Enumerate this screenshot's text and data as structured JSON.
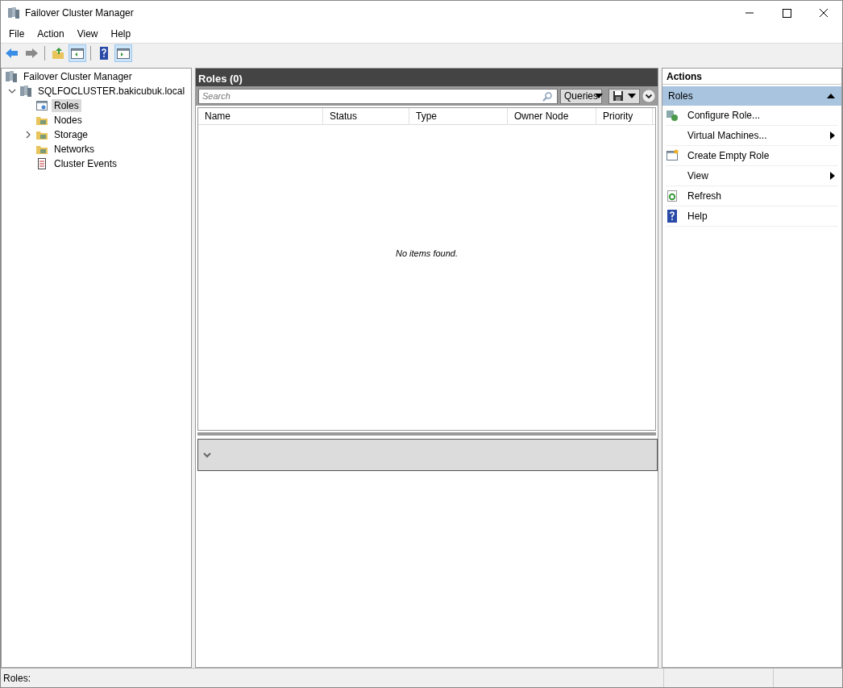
{
  "window": {
    "title": "Failover Cluster Manager"
  },
  "menu": [
    "File",
    "Action",
    "View",
    "Help"
  ],
  "toolbar": [
    {
      "pressed": false
    },
    {
      "pressed": false
    },
    {
      "pressed": false
    },
    {
      "pressed": true
    },
    {
      "pressed": false
    },
    {
      "pressed": true
    }
  ],
  "tree": [
    {
      "label": "Failover Cluster Manager",
      "selected": false,
      "children": [
        {
          "label": "SQLFOCLUSTER.bakicubuk.local",
          "selected": false,
          "expanded": true,
          "children": [
            {
              "label": "Roles",
              "selected": true
            },
            {
              "label": "Nodes",
              "selected": false
            },
            {
              "label": "Storage",
              "selected": false,
              "expanded": false
            },
            {
              "label": "Networks",
              "selected": false
            },
            {
              "label": "Cluster Events",
              "selected": false
            }
          ]
        }
      ]
    }
  ],
  "center": {
    "title": "Roles (0)",
    "search": {
      "placeholder": "Search"
    },
    "queries_button": "Queries",
    "columns": [
      "Name",
      "Status",
      "Type",
      "Owner Node",
      "Priority"
    ],
    "empty_message": "No items found."
  },
  "actions": {
    "title": "Actions",
    "section": "Roles",
    "items": [
      {
        "label": "Configure Role...",
        "submenu": false
      },
      {
        "label": "Virtual Machines...",
        "submenu": true
      },
      {
        "label": "Create Empty Role",
        "submenu": false
      },
      {
        "label": "View",
        "submenu": true
      },
      {
        "label": "Refresh",
        "submenu": false
      },
      {
        "label": "Help",
        "submenu": false
      }
    ]
  },
  "status_bar": "Roles:"
}
